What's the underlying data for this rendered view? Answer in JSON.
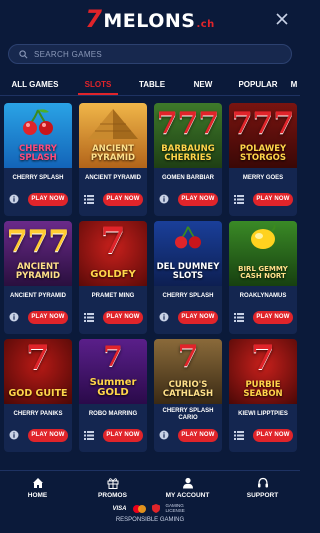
{
  "logo": {
    "seven": "7",
    "name": "MELONS",
    "tld": ".ch"
  },
  "search": {
    "placeholder": "SEARCH GAMES"
  },
  "tabs": [
    {
      "label": "ALL GAMES",
      "active": false
    },
    {
      "label": "SLOTS",
      "active": true
    },
    {
      "label": "TABLE",
      "active": false
    },
    {
      "label": "NEW",
      "active": false
    },
    {
      "label": "POPULAR",
      "active": false
    },
    {
      "label": "M",
      "active": false
    }
  ],
  "games": [
    {
      "art": "CHERRY SPLASH",
      "caption": "CHERRY SPLASH",
      "icon": "info",
      "play": "PLAY NOW"
    },
    {
      "art": "ANCIENT PYRAMID",
      "caption": "ANCIENT PYRAMID",
      "icon": "list",
      "play": "PLAY NOW"
    },
    {
      "art": "BARBAUNG CHERRIES",
      "caption": "GOMEN BARBIAR",
      "icon": "info",
      "play": "PLAY NOW"
    },
    {
      "art": "POLAWEY STORGOS",
      "caption": "MERRY GOES",
      "icon": "list",
      "play": "PLAY NOW"
    },
    {
      "art": "ANCIENT PYRAMID",
      "caption": "ANCIENT PYRAMID",
      "icon": "info",
      "play": "PLAY NOW"
    },
    {
      "art": "GOLDFY",
      "caption": "PRAMET MING",
      "icon": "list",
      "play": "PLAY NOW"
    },
    {
      "art": "DEL DUMNEY SLOTS",
      "caption": "CHERRY SPLASH",
      "icon": "info",
      "play": "PLAY NOW"
    },
    {
      "art": "BIRL GEMMY CASH NORT",
      "caption": "ROAKLYNAMUS",
      "icon": "list",
      "play": "PLAY NOW"
    },
    {
      "art": "GOD GUITE",
      "caption": "CHERRY PANIKS",
      "icon": "info",
      "play": "PLAY NOW"
    },
    {
      "art": "Summer GOLD",
      "caption": "ROBO MARRING",
      "icon": "list",
      "play": "PLAY NOW"
    },
    {
      "art": "CURIO'S CATHLASH",
      "caption": "CHERRY SPLASH CARIO",
      "icon": "info",
      "play": "PLAY NOW"
    },
    {
      "art": "PURBIE SEABON",
      "caption": "KIEWI LIPPTPIES",
      "icon": "list",
      "play": "PLAY NOW"
    }
  ],
  "nav": [
    {
      "label": "HOME",
      "icon": "home-icon"
    },
    {
      "label": "PROMOS",
      "icon": "gift-icon"
    },
    {
      "label": "MY ACCOUNT",
      "icon": "user-icon"
    },
    {
      "label": "SUPPORT",
      "icon": "headset-icon"
    }
  ],
  "payments": {
    "visa": "VISA",
    "license": "GAMING LICENSE"
  },
  "footer": {
    "responsible": "RESPONSIBLE GAMING"
  },
  "colors": {
    "accent": "#e0242a",
    "background": "#0b1a3a",
    "card": "#142650"
  }
}
